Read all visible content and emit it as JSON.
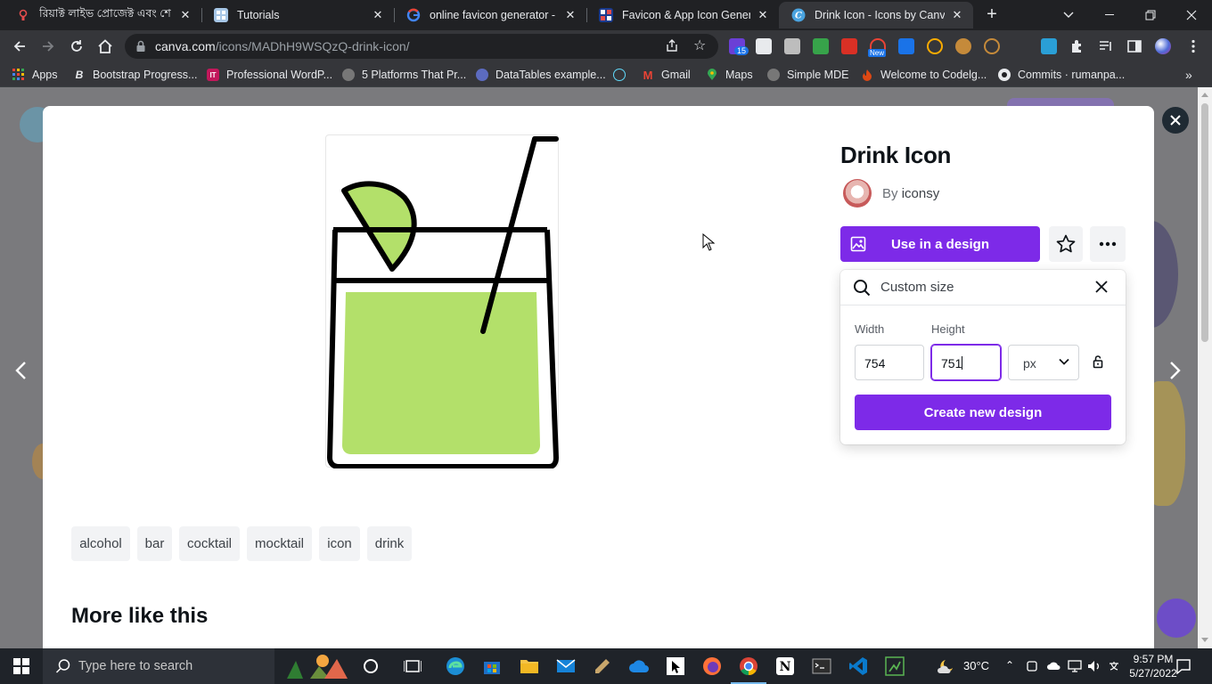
{
  "browser": {
    "tabs": [
      {
        "title": "রিয়াক্ট লাইভ প্রোজেক্ট এবং শে",
        "favicon": "react-icon"
      },
      {
        "title": "Tutorials",
        "favicon": "tutorials-icon"
      },
      {
        "title": "online favicon generator - G",
        "favicon": "google-icon"
      },
      {
        "title": "Favicon & App Icon Generat",
        "favicon": "dans-dole-icon"
      },
      {
        "title": "Drink Icon - Icons by Canva",
        "favicon": "canva-icon",
        "active": true
      }
    ],
    "url_host": "canva.com",
    "url_path": "/icons/MADhH9WSQzQ-drink-icon/",
    "extension_badge": "15",
    "extension_new_badge": "New",
    "bookmarks": [
      {
        "label": "Apps",
        "icon": "apps-grid-icon"
      },
      {
        "label": "Bootstrap Progress...",
        "icon": "bootstrap-icon"
      },
      {
        "label": "Professional WordP...",
        "icon": "it-icon"
      },
      {
        "label": "5 Platforms That Pr...",
        "icon": "globe-icon"
      },
      {
        "label": "DataTables example...",
        "icon": "datatables-icon"
      },
      {
        "label": "",
        "icon": "react-icon"
      },
      {
        "label": "Gmail",
        "icon": "gmail-icon"
      },
      {
        "label": "Maps",
        "icon": "maps-icon"
      },
      {
        "label": "Simple MDE",
        "icon": "globe-icon"
      },
      {
        "label": "Welcome to Codelg...",
        "icon": "codelgniter-icon"
      },
      {
        "label": "Commits · rumanpa...",
        "icon": "github-icon"
      }
    ]
  },
  "icon_page": {
    "title": "Drink Icon",
    "author_prefix": "By",
    "author": "iconsy",
    "use_button": "Use in a design",
    "panel": {
      "search_value": "Custom size",
      "width_label": "Width",
      "height_label": "Height",
      "width_value": "754",
      "height_value": "751",
      "unit": "px",
      "create_button": "Create new design"
    },
    "tags": [
      "alcohol",
      "bar",
      "cocktail",
      "mocktail",
      "icon",
      "drink"
    ],
    "more_title": "More like this"
  },
  "taskbar": {
    "search_placeholder": "Type here to search",
    "temperature": "30°C",
    "time": "9:57 PM",
    "date": "5/27/2022"
  },
  "colors": {
    "accent": "#7d2ae8",
    "lime": "#b3e06a",
    "browser_dark": "#202124"
  }
}
